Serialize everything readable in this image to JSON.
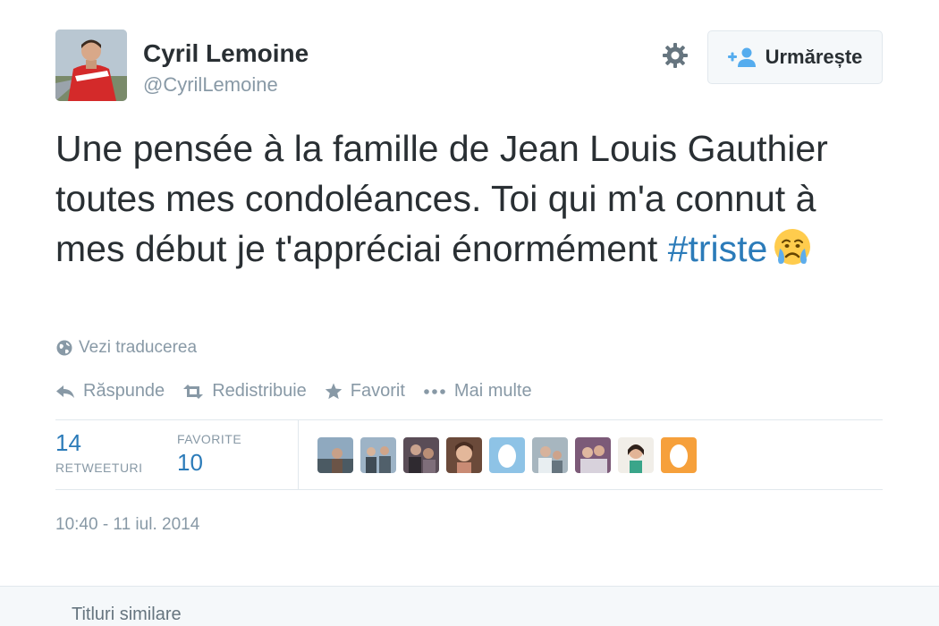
{
  "author": {
    "name": "Cyril Lemoine",
    "handle": "@CyrilLemoine"
  },
  "follow_button": {
    "label": "Urmărește"
  },
  "icons": {
    "settings": "gear-icon",
    "follow": "add-user-icon",
    "translate": "globe-icon",
    "reply": "reply-icon",
    "retweet": "retweet-icon",
    "favorite": "star-icon",
    "more": "more-dots-icon",
    "emoji": "crying-face-emoji"
  },
  "tweet": {
    "text": "Une pensée à la famille de Jean Louis Gauthier toutes mes condoléances. Toi qui m'a connut à mes début je t'appréciai énormément ",
    "hashtag": "#triste"
  },
  "translate_link": "Vezi traducerea",
  "actions": {
    "reply": "Răspunde",
    "retweet": "Redistribuie",
    "favorite": "Favorit",
    "more": "Mai multe"
  },
  "stats": {
    "retweets": {
      "count": "14",
      "label": "RETWEETURI"
    },
    "favorites": {
      "count": "10",
      "label": "FAVORITE"
    }
  },
  "timestamp": "10:40 - 11 iul. 2014",
  "related": {
    "title": "Titluri similare"
  },
  "colors": {
    "link": "#2b7bb9",
    "muted": "#8899a6",
    "text": "#292f33",
    "follow_icon": "#55acee",
    "border": "#e1e8ed"
  }
}
